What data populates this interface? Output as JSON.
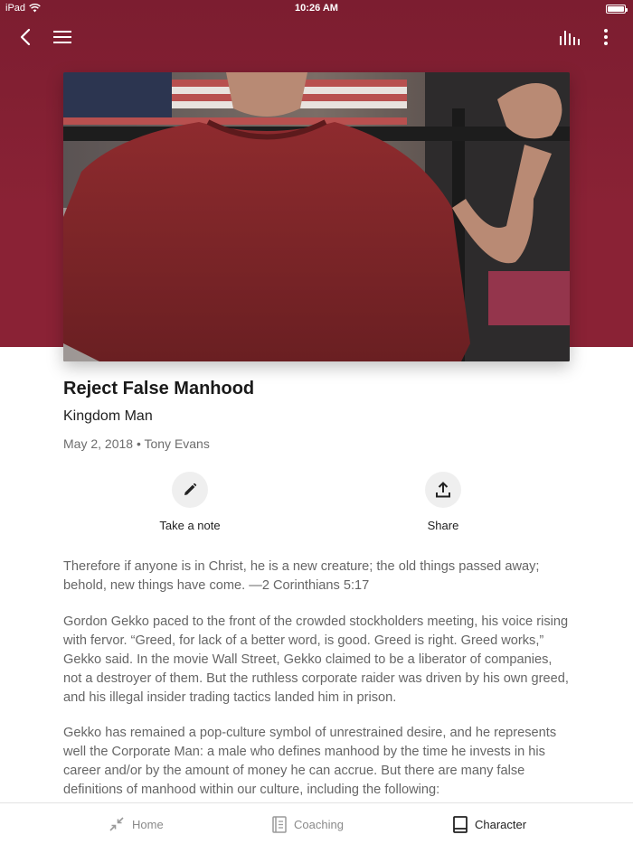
{
  "status_bar": {
    "device": "iPad",
    "time": "10:26 AM"
  },
  "toolbar": {
    "back_icon": "chevron-left-icon",
    "menu_icon": "hamburger-menu-icon",
    "audio_icon": "audio-bars-icon",
    "more_icon": "more-vertical-icon"
  },
  "article": {
    "title": "Reject False Manhood",
    "series": "Kingdom Man",
    "meta": "May 2, 2018 • Tony Evans",
    "actions": [
      {
        "label": "Take a note",
        "icon": "pencil-icon"
      },
      {
        "label": "Share",
        "icon": "share-icon"
      }
    ],
    "paragraphs": [
      "Therefore if anyone is in Christ, he is a new creature; the old things passed away; behold, new things have come. —2 Corinthians 5:17",
      "Gordon Gekko paced to the front of the crowded stockholders meeting, his voice rising with fervor. “Greed, for lack of a better word, is good. Greed is right. Greed works,” Gekko said. In the movie Wall Street, Gekko claimed to be a liberator of companies, not a destroyer of them. But the ruthless corporate raider was driven by his own greed, and his illegal insider trading tactics landed him in prison.",
      "Gekko has remained a pop-culture symbol of unrestrained desire, and he represents well the Corporate Man: a male who defines manhood by the time he invests in his career and/or by the amount of money he can accrue. But there are many false definitions of manhood within our culture, including the following:"
    ]
  },
  "tabs": [
    {
      "label": "Home",
      "icon": "collapse-arrows-icon",
      "active": false
    },
    {
      "label": "Coaching",
      "icon": "notebook-icon",
      "active": false
    },
    {
      "label": "Character",
      "icon": "book-icon",
      "active": true
    }
  ],
  "colors": {
    "header": "#8a2235",
    "text_secondary": "#666666"
  }
}
